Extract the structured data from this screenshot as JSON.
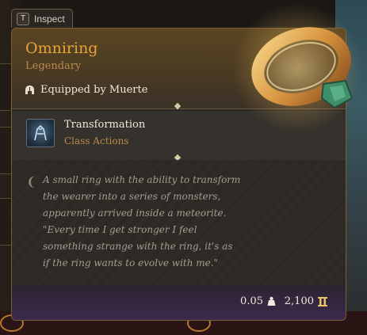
{
  "inspect": {
    "key": "T",
    "label": "Inspect"
  },
  "item": {
    "name": "Omniring",
    "rarity": "Legendary",
    "equipped_by": "Equipped by Muerte",
    "ability": {
      "name": "Transformation",
      "type": "Class Actions"
    },
    "description": "A small ring with the ability to transform the wearer into a series of monsters, apparently arrived inside a meteorite. \"Every time I get stronger I feel something strange with the ring, it's as if the ring wants to evolve with me.\"",
    "weight": "0.05",
    "price": "2,100"
  },
  "colors": {
    "title": "#e8a33a",
    "rarity": "#b98a4c",
    "ring_gold": "#e3a44a",
    "gem": "#3f8f6a"
  },
  "icons": {
    "equipped": "helmet-icon",
    "ability": "transformation-icon",
    "quote": "quote-icon",
    "weight": "weight-icon",
    "price": "gold-icon"
  }
}
